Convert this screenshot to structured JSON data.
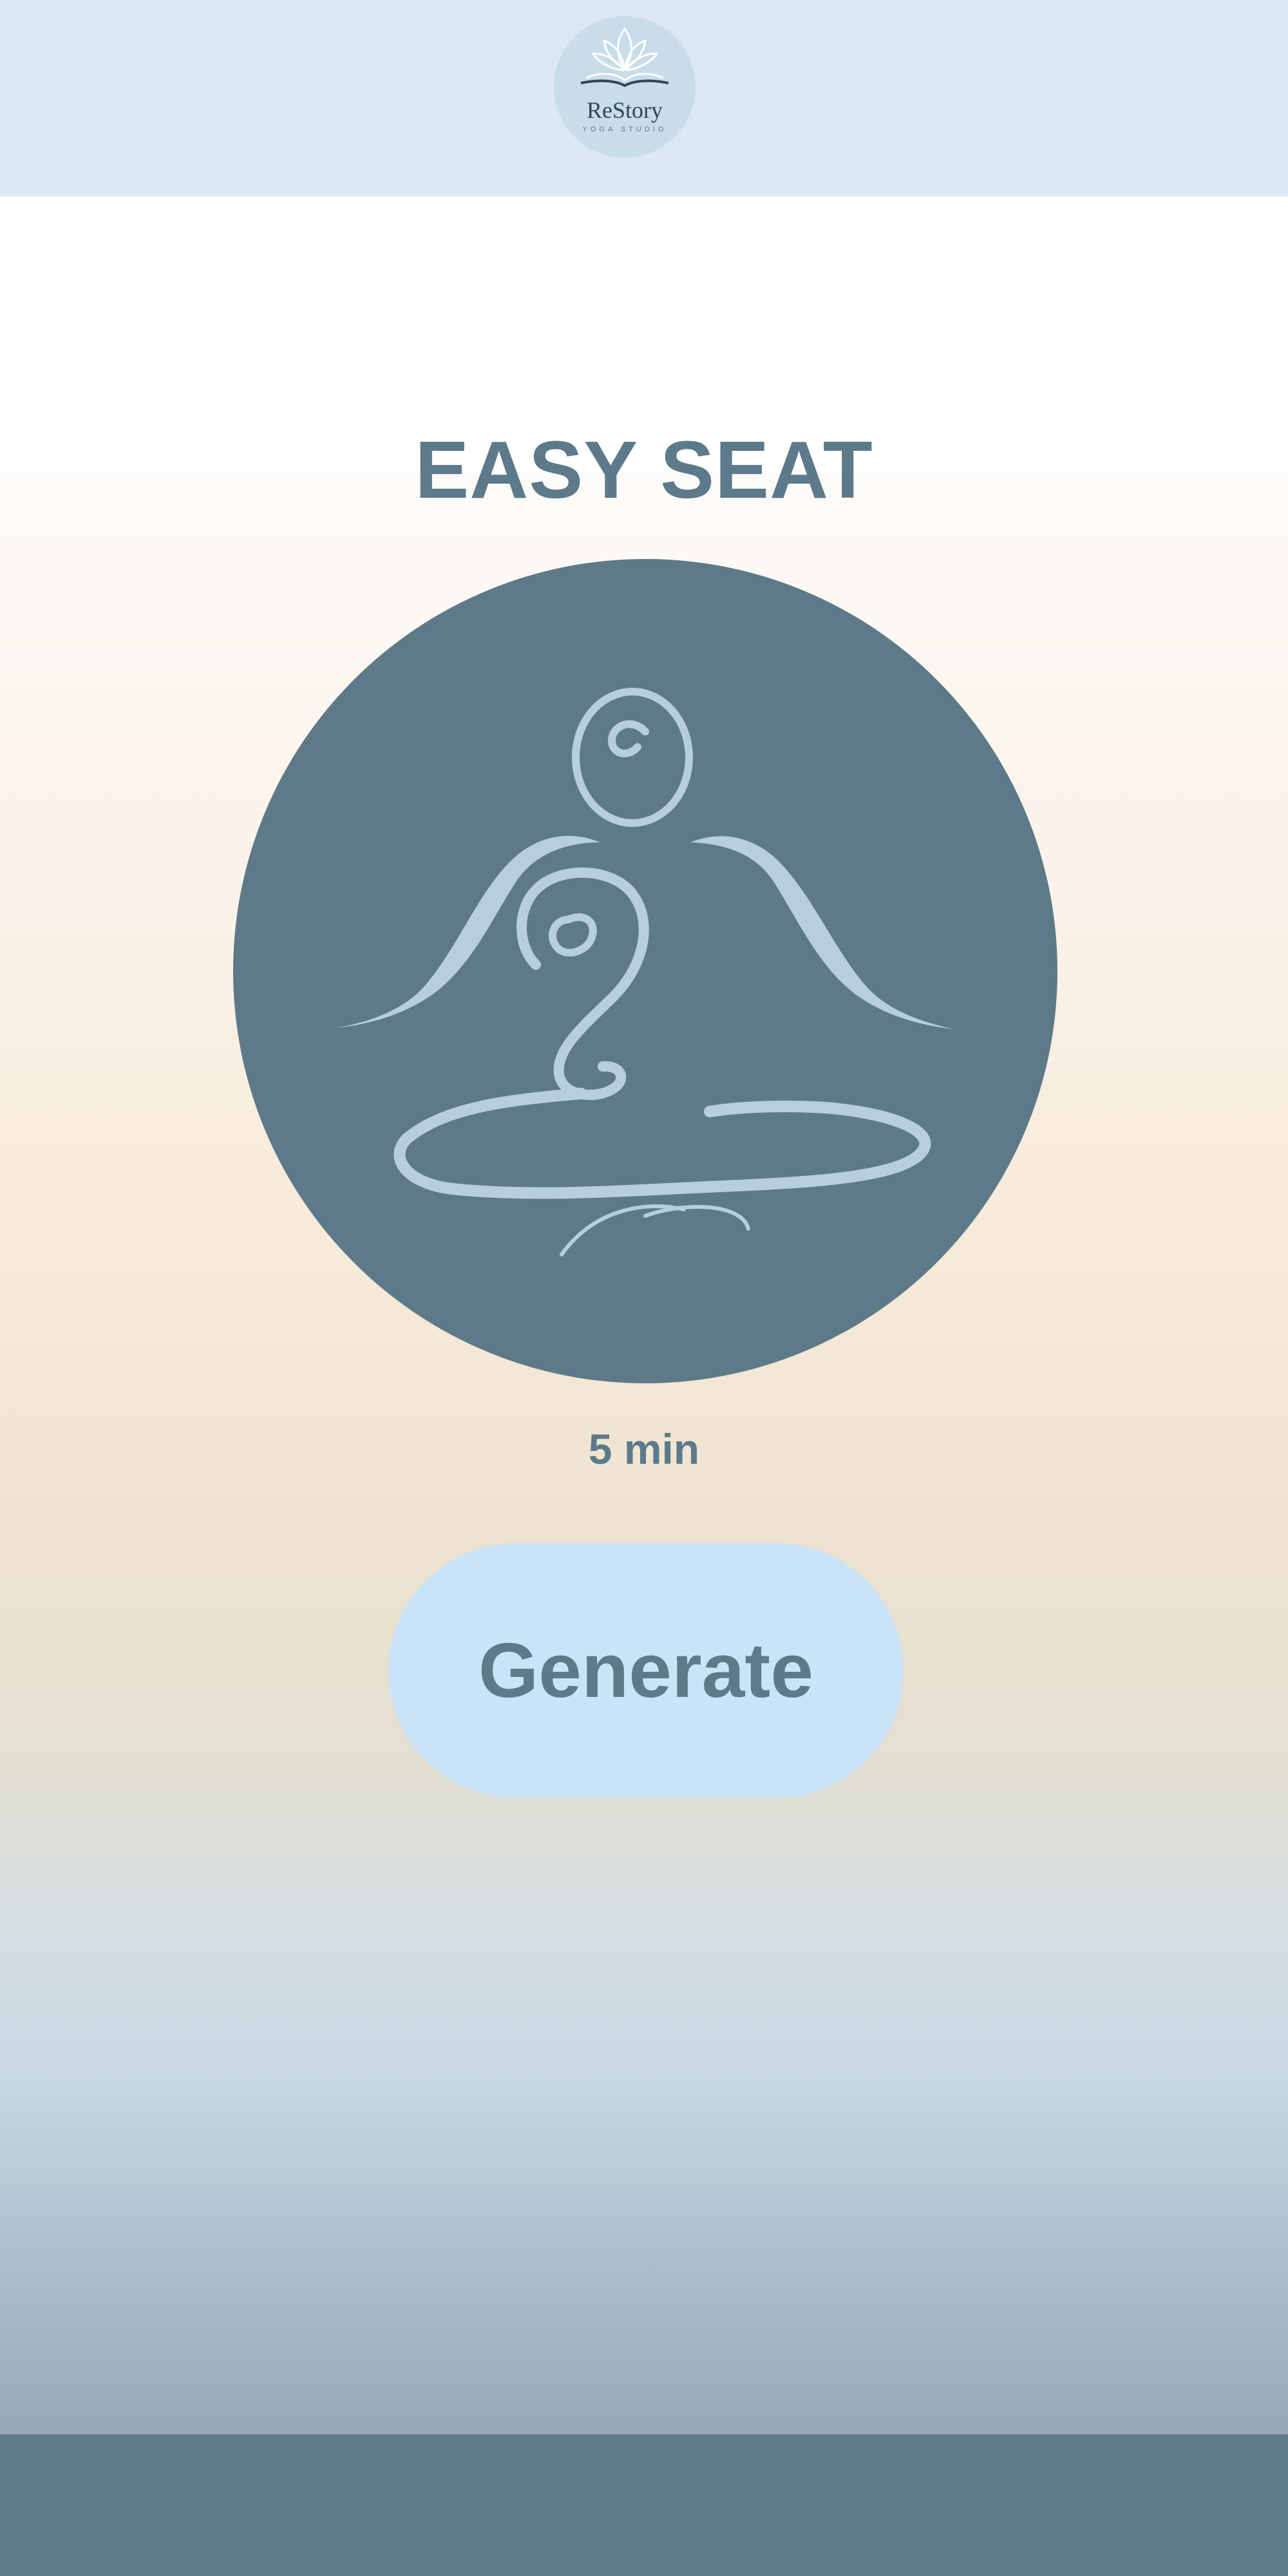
{
  "header": {
    "logo": {
      "name": "ReStory",
      "tagline": "YOGA STUDIO",
      "icon": "lotus-book-icon"
    }
  },
  "pose": {
    "title": "EASY SEAT",
    "illustration": "meditation-pose-icon",
    "duration": "5 min"
  },
  "actions": {
    "generate_label": "Generate"
  },
  "colors": {
    "header_bg": "#dde9f2",
    "primary_slate": "#5e7a89",
    "button_bg": "#cbe3f7",
    "figure_stroke": "#b7cde0"
  }
}
